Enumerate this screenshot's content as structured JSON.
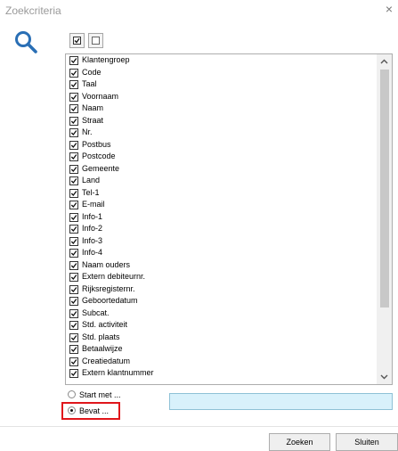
{
  "window": {
    "title": "Zoekcriteria",
    "close_label": "×"
  },
  "toolbar": {
    "check_all": "check-all",
    "uncheck_all": "uncheck-all"
  },
  "fields": [
    {
      "label": "Klantengroep",
      "checked": true
    },
    {
      "label": "Code",
      "checked": true
    },
    {
      "label": "Taal",
      "checked": true
    },
    {
      "label": "Voornaam",
      "checked": true
    },
    {
      "label": "Naam",
      "checked": true
    },
    {
      "label": "Straat",
      "checked": true
    },
    {
      "label": "Nr.",
      "checked": true
    },
    {
      "label": "Postbus",
      "checked": true
    },
    {
      "label": "Postcode",
      "checked": true
    },
    {
      "label": "Gemeente",
      "checked": true
    },
    {
      "label": "Land",
      "checked": true
    },
    {
      "label": "Tel-1",
      "checked": true
    },
    {
      "label": "E-mail",
      "checked": true
    },
    {
      "label": "Info-1",
      "checked": true
    },
    {
      "label": "Info-2",
      "checked": true
    },
    {
      "label": "Info-3",
      "checked": true
    },
    {
      "label": "Info-4",
      "checked": true
    },
    {
      "label": "Naam ouders",
      "checked": true
    },
    {
      "label": "Extern debiteurnr.",
      "checked": true
    },
    {
      "label": "Rijksregisternr.",
      "checked": true
    },
    {
      "label": "Geboortedatum",
      "checked": true
    },
    {
      "label": "Subcat.",
      "checked": true
    },
    {
      "label": "Std. activiteit",
      "checked": true
    },
    {
      "label": "Std. plaats",
      "checked": true
    },
    {
      "label": "Betaalwijze",
      "checked": true
    },
    {
      "label": "Creatiedatum",
      "checked": true
    },
    {
      "label": "Extern klantnummer",
      "checked": true
    }
  ],
  "match_mode": {
    "options": [
      {
        "label": "Start met ...",
        "selected": false
      },
      {
        "label": "Bevat ...",
        "selected": true
      }
    ]
  },
  "search": {
    "value": ""
  },
  "buttons": {
    "search": "Zoeken",
    "close": "Sluiten"
  },
  "colors": {
    "highlight": "#e0161b",
    "search_field": "#d8f1fb",
    "icon": "#2a6fb5"
  }
}
